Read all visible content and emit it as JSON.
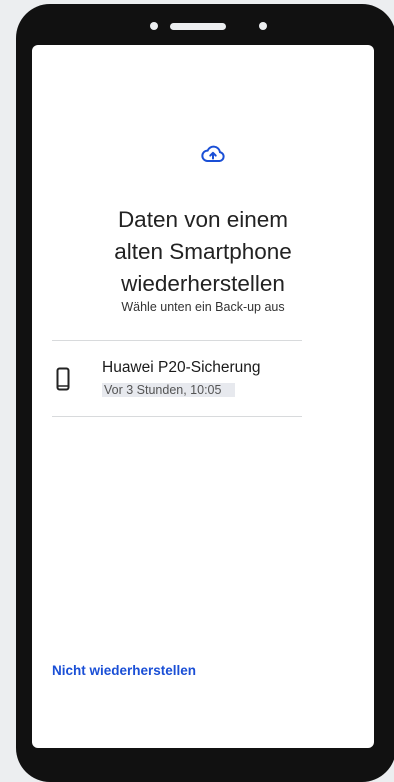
{
  "restore": {
    "title": "Daten von einem\nalten Smartphone\nwiederherstellen",
    "subtitle": "Wähle unten ein Back-up aus",
    "backups": [
      {
        "name": "Huawei P20-Sicherung",
        "time": "Vor 3 Stunden, 10:05"
      }
    ],
    "skip_label": "Nicht wiederherstellen"
  },
  "icons": {
    "header": "cloud-upload-icon",
    "device": "smartphone-icon"
  },
  "colors": {
    "accent": "#1a4fd6",
    "frame": "#111111",
    "background": "#eceef0"
  }
}
